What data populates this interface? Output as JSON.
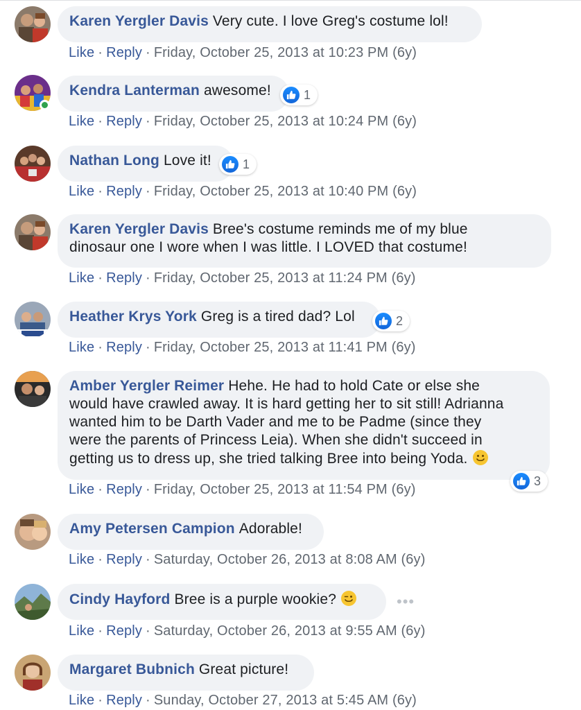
{
  "sep": "·",
  "comments": [
    {
      "author": "Karen Yergler Davis",
      "text": "Very cute. I love Greg's costume lol!",
      "like": "Like",
      "reply": "Reply",
      "time": "Friday, October 25, 2013 at 10:23 PM (6y)"
    },
    {
      "author": "Kendra Lanterman",
      "text": "awesome!",
      "like": "Like",
      "reply": "Reply",
      "time": "Friday, October 25, 2013 at 10:24 PM (6y)",
      "reactions": "1",
      "online": true
    },
    {
      "author": "Nathan Long",
      "text": "Love it!",
      "like": "Like",
      "reply": "Reply",
      "time": "Friday, October 25, 2013 at 10:40 PM (6y)",
      "reactions": "1"
    },
    {
      "author": "Karen Yergler Davis",
      "text_lines": [
        "Bree's costume reminds me of my blue",
        "dinosaur one I wore when I was little. I LOVED that costume!"
      ],
      "like": "Like",
      "reply": "Reply",
      "time": "Friday, October 25, 2013 at 11:24 PM (6y)"
    },
    {
      "author": "Heather Krys York",
      "text": "Greg is a tired dad? Lol",
      "like": "Like",
      "reply": "Reply",
      "time": "Friday, October 25, 2013 at 11:41 PM (6y)",
      "reactions": "2"
    },
    {
      "author": "Amber Yergler Reimer",
      "text_lines": [
        "Hehe. He had to hold Cate or else she",
        "would have crawled away. It is hard getting her to sit still! Adrianna",
        "wanted him to be Darth Vader and me to be Padme (since they",
        "were the parents of Princess Leia). When she didn't succeed in",
        "getting us to dress up, she tried talking Bree into being Yoda."
      ],
      "emoji": "smiling-face-emoji",
      "like": "Like",
      "reply": "Reply",
      "time": "Friday, October 25, 2013 at 11:54 PM (6y)",
      "reactions": "3"
    },
    {
      "author": "Amy Petersen Campion",
      "text": "Adorable!",
      "like": "Like",
      "reply": "Reply",
      "time": "Saturday, October 26, 2013 at 8:08 AM (6y)"
    },
    {
      "author": "Cindy Hayford",
      "text": "Bree is a purple wookie?",
      "emoji": "winking-face-emoji",
      "like": "Like",
      "reply": "Reply",
      "time": "Saturday, October 26, 2013 at 9:55 AM (6y)",
      "more": "•••"
    },
    {
      "author": "Margaret Bubnich",
      "text": "Great picture!",
      "like": "Like",
      "reply": "Reply",
      "time": "Sunday, October 27, 2013 at 5:45 AM (6y)"
    }
  ],
  "colors": {
    "link": "#385898",
    "meta": "#606770",
    "bubble": "#f0f2f5",
    "like_blue": "#1877f2",
    "online": "#31a24c"
  }
}
